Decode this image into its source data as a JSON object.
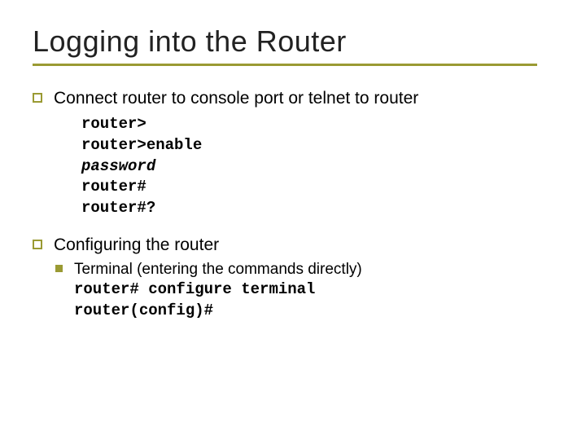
{
  "title": "Logging into the Router",
  "bullets": [
    {
      "text": "Connect router to console port or telnet to router",
      "code": [
        {
          "text": "router>",
          "italic": false
        },
        {
          "text": "router>enable",
          "italic": false
        },
        {
          "text": "password",
          "italic": true
        },
        {
          "text": "router#",
          "italic": false
        },
        {
          "text": "router#?",
          "italic": false
        }
      ]
    },
    {
      "text": "Configuring the router",
      "sub": {
        "label": "Terminal (entering the commands directly)",
        "code": [
          "router# configure terminal",
          "router(config)#"
        ]
      }
    }
  ]
}
